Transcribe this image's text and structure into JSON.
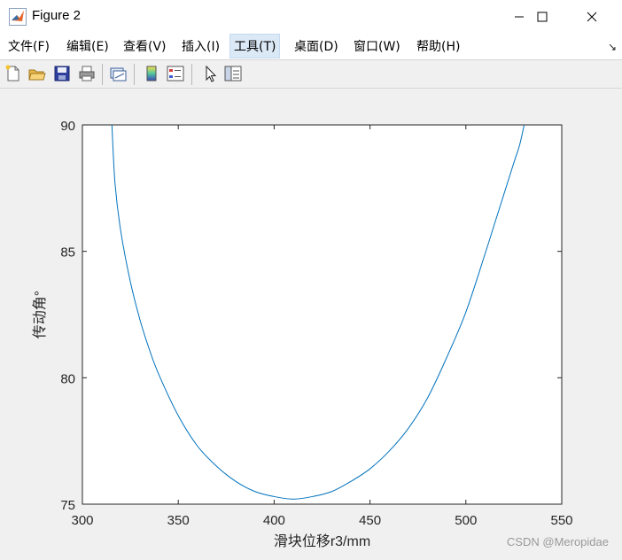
{
  "window": {
    "title": "Figure 2",
    "icon": "matlab-logo-icon",
    "controls": {
      "minimize": "minimize-icon",
      "maximize": "maximize-icon",
      "close": "close-icon"
    }
  },
  "menu": {
    "items": [
      {
        "label": "文件(F)"
      },
      {
        "label": "编辑(E)"
      },
      {
        "label": "查看(V)"
      },
      {
        "label": "插入(I)"
      },
      {
        "label": "工具(T)"
      },
      {
        "label": "桌面(D)"
      },
      {
        "label": "窗口(W)"
      },
      {
        "label": "帮助(H)"
      }
    ],
    "active_index": 4,
    "dock_glyph": "↘"
  },
  "toolbar": {
    "icons": [
      "new-figure-icon",
      "open-file-icon",
      "save-icon",
      "print-icon",
      "link-plot-icon",
      "colorbar-icon",
      "legend-icon",
      "pointer-icon",
      "property-editor-icon"
    ]
  },
  "chart_data": {
    "type": "line",
    "title": "",
    "xlabel": "滑块位移r3/mm",
    "ylabel": "传动角°",
    "xlim": [
      300,
      550
    ],
    "ylim": [
      75,
      90
    ],
    "xticks": [
      "300",
      "350",
      "400",
      "450",
      "500",
      "550"
    ],
    "yticks": [
      "75",
      "80",
      "85",
      "90"
    ],
    "grid": false,
    "line_color": "#0072bd",
    "series": [
      {
        "x": [
          315.4,
          317,
          320,
          325,
          330,
          335,
          340,
          350,
          360,
          370,
          380,
          390,
          400,
          410,
          420,
          430,
          440,
          450,
          460,
          470,
          480,
          490,
          500,
          510,
          515,
          520,
          525,
          528,
          530.4
        ],
        "values": [
          90,
          87.7,
          85.8,
          83.8,
          82.3,
          81.1,
          80.1,
          78.5,
          77.3,
          76.5,
          75.9,
          75.5,
          75.3,
          75.2,
          75.3,
          75.5,
          75.9,
          76.4,
          77.1,
          78.0,
          79.2,
          80.8,
          82.6,
          84.9,
          86.1,
          87.3,
          88.5,
          89.2,
          90
        ]
      }
    ]
  },
  "watermark": "CSDN @Meropidae"
}
